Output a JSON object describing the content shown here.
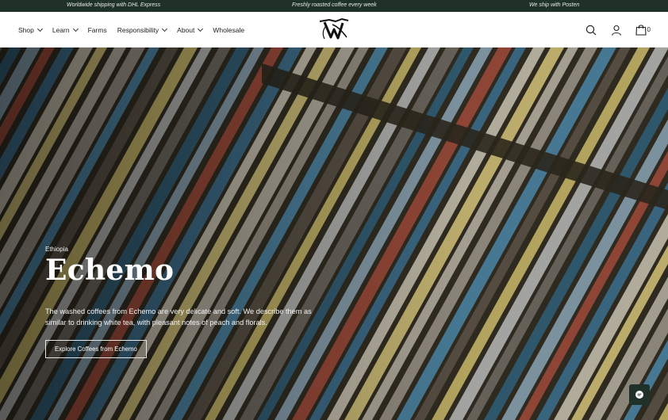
{
  "announcement": {
    "left": "Worldwide shipping with DHL Express",
    "center": "Freshly roasted coffee every week",
    "right": "We ship with Posten"
  },
  "nav": {
    "shop": "Shop",
    "learn": "Learn",
    "farms": "Farms",
    "responsibility": "Responsibility",
    "about": "About",
    "wholesale": "Wholesale"
  },
  "header": {
    "cart_count": "0",
    "icons": [
      "search-icon",
      "account-icon",
      "cart-icon"
    ]
  },
  "hero": {
    "eyebrow": "Ethiopia",
    "title": "Echemo",
    "description": "The washed coffees from Echemo are very delicate and soft. We describe them as similar to drinking white tea, with pleasant notes of peach and florals.",
    "button": "Explore Coffees from Echemo"
  },
  "colors": {
    "announcement_bg": "#1f3128",
    "chat_bg": "#1f3128"
  }
}
